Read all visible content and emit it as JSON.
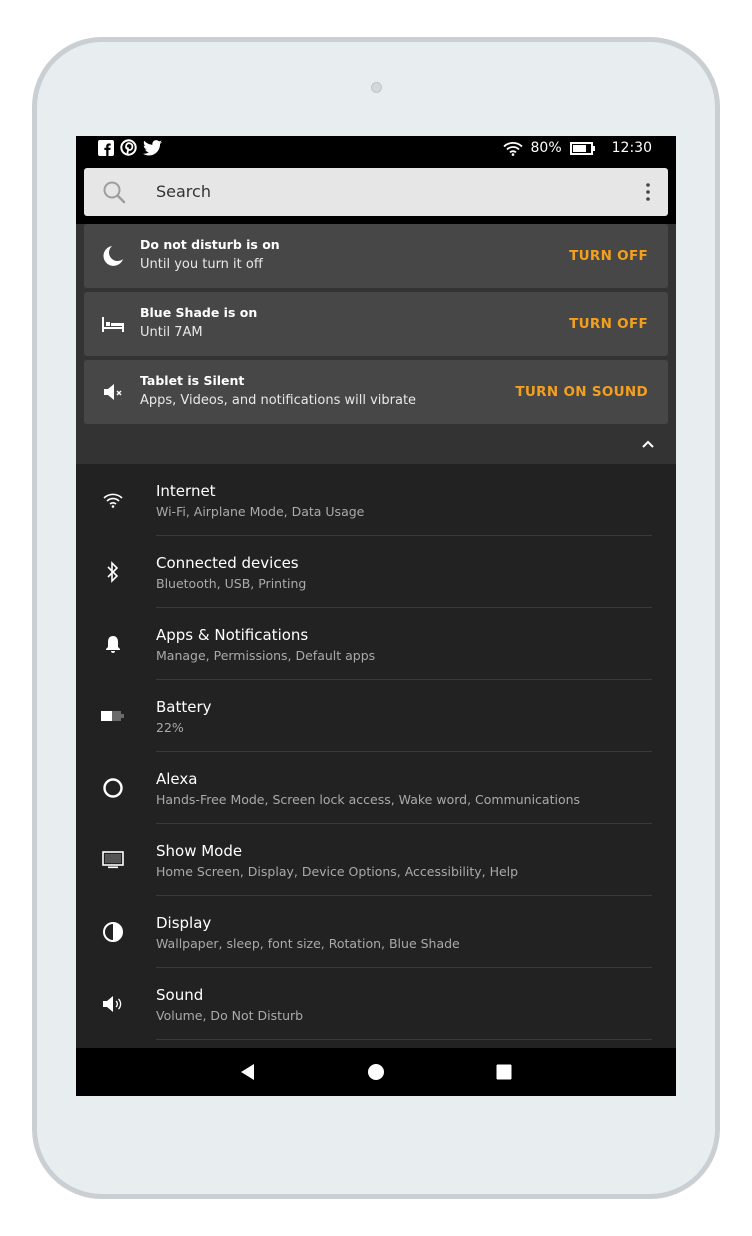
{
  "status_bar": {
    "battery_percent": "80%",
    "time": "12:30",
    "app_icons": [
      "facebook-icon",
      "pinterest-icon",
      "twitter-icon"
    ]
  },
  "search": {
    "placeholder": "Search"
  },
  "notifications": [
    {
      "title": "Do not disturb is on",
      "subtitle": "Until you turn it off",
      "action": "TURN OFF",
      "icon": "moon-icon"
    },
    {
      "title": "Blue Shade is on",
      "subtitle": "Until 7AM",
      "action": "TURN OFF",
      "icon": "bed-icon"
    },
    {
      "title": "Tablet is Silent",
      "subtitle": "Apps, Videos, and notifications will vibrate",
      "action": "TURN ON SOUND",
      "icon": "speaker-muted-icon"
    }
  ],
  "settings": [
    {
      "title": "Internet",
      "subtitle": "Wi-Fi, Airplane Mode, Data Usage",
      "icon": "wifi-icon"
    },
    {
      "title": "Connected devices",
      "subtitle": "Bluetooth, USB, Printing",
      "icon": "bluetooth-icon"
    },
    {
      "title": "Apps & Notifications",
      "subtitle": "Manage, Permissions, Default apps",
      "icon": "bell-icon"
    },
    {
      "title": "Battery",
      "subtitle": "22%",
      "icon": "battery-icon"
    },
    {
      "title": "Alexa",
      "subtitle": "Hands-Free Mode, Screen lock access, Wake word, Communications",
      "icon": "alexa-ring-icon"
    },
    {
      "title": "Show Mode",
      "subtitle": "Home Screen, Display, Device Options, Accessibility, Help",
      "icon": "monitor-icon"
    },
    {
      "title": "Display",
      "subtitle": "Wallpaper, sleep, font size, Rotation, Blue Shade",
      "icon": "contrast-icon"
    },
    {
      "title": "Sound",
      "subtitle": "Volume, Do Not Disturb",
      "icon": "speaker-icon"
    }
  ],
  "colors": {
    "accent": "#f3a01f",
    "notification_bg": "#474747",
    "list_bg": "#222222"
  }
}
